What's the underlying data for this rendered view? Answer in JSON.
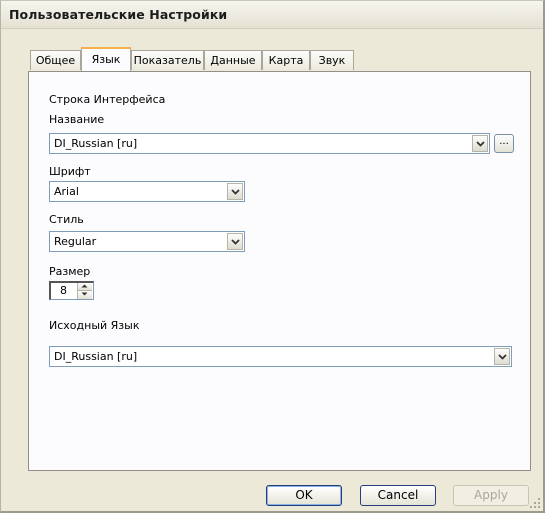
{
  "window": {
    "title": "Пользовательские Настройки"
  },
  "tabs": [
    {
      "label": "Общее",
      "active": false
    },
    {
      "label": "Язык",
      "active": true
    },
    {
      "label": "Показатель",
      "active": false
    },
    {
      "label": "Данные",
      "active": false
    },
    {
      "label": "Карта",
      "active": false
    },
    {
      "label": "Звук",
      "active": false
    }
  ],
  "panel": {
    "section_title": "Строка Интерфейса",
    "name": {
      "label": "Название",
      "value": "DI_Russian [ru]",
      "browse_label": "..."
    },
    "font": {
      "label": "Шрифт",
      "value": "Arial"
    },
    "style": {
      "label": "Стиль",
      "value": "Regular"
    },
    "size": {
      "label": "Размер",
      "value": "8"
    },
    "source_language": {
      "label": "Исходный Язык",
      "value": "DI_Russian [ru]"
    }
  },
  "buttons": {
    "ok": "OK",
    "cancel": "Cancel",
    "apply": "Apply"
  },
  "colors": {
    "dialog_bg": "#ece9d8",
    "panel_bg": "#fcfcfe",
    "active_tab_accent": "#f5b04a",
    "field_border": "#7f9db9",
    "button_border": "#233e7a"
  },
  "icons": {
    "dropdown": "chevron-down-icon",
    "spin_up": "spin-up-icon",
    "spin_down": "spin-down-icon",
    "resize": "resize-grip-icon"
  }
}
